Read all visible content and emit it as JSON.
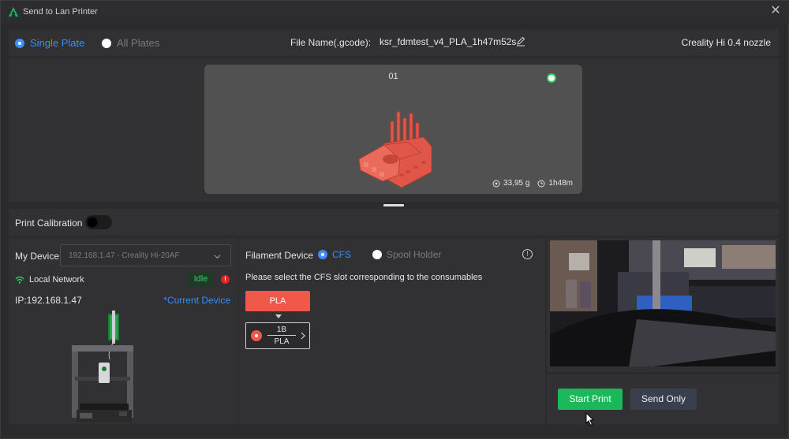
{
  "window": {
    "title": "Send to Lan Printer"
  },
  "topbar": {
    "single_plate": "Single Plate",
    "all_plates": "All Plates",
    "file_label": "File Name(.gcode):",
    "file_name": "ksr_fdmtest_v4_PLA_1h47m52s",
    "printer_name": "Creality Hi 0.4 nozzle"
  },
  "plate": {
    "number": "01",
    "weight": "33,95 g",
    "time": "1h48m"
  },
  "calibration": {
    "label": "Print Calibration",
    "enabled": false
  },
  "device": {
    "label": "My Device",
    "selected": "192.168.1.47 - Creality Hi-20AF",
    "network": "Local Network",
    "status": "Idle",
    "warning": "!",
    "ip": "IP:192.168.1.47",
    "current": "*Current Device"
  },
  "filament": {
    "label": "Filament Device",
    "cfs": "CFS",
    "spool": "Spool Holder",
    "info": "!",
    "hint": "Please select the CFS slot corresponding to the consumables",
    "material": "PLA",
    "slot_id": "1B",
    "slot_material": "PLA"
  },
  "actions": {
    "start": "Start Print",
    "send": "Send Only"
  },
  "colors": {
    "accent": "#3b8cf5",
    "filament": "#f0584a",
    "start": "#1bb85a",
    "idle": "#2fd061"
  }
}
